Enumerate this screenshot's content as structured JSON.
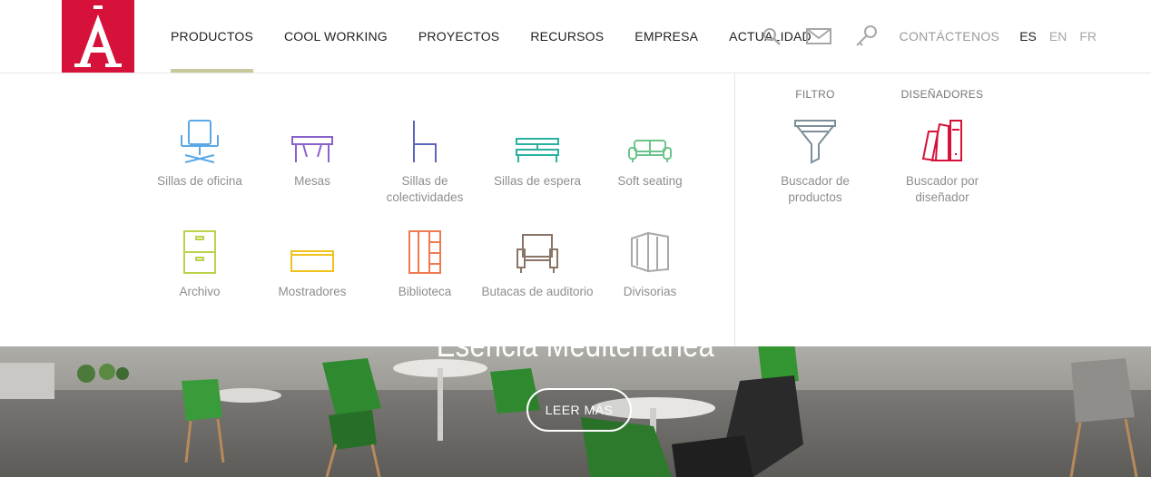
{
  "header": {
    "logo_alt": "Actiu",
    "nav": [
      {
        "label": "PRODUCTOS",
        "active": true
      },
      {
        "label": "COOL WORKING",
        "active": false
      },
      {
        "label": "PROYECTOS",
        "active": false
      },
      {
        "label": "RECURSOS",
        "active": false
      },
      {
        "label": "EMPRESA",
        "active": false
      },
      {
        "label": "ACTUALIDAD",
        "active": false
      }
    ],
    "icons": [
      "search-icon",
      "mail-icon",
      "key-icon"
    ],
    "contact_label": "CONTÁCTENOS",
    "languages": [
      {
        "code": "ES",
        "active": true
      },
      {
        "code": "EN",
        "active": false
      },
      {
        "code": "FR",
        "active": false
      }
    ],
    "accent_color": "#d6123a",
    "active_underline_color": "#c8c99a"
  },
  "menu": {
    "categories": [
      {
        "label": "Sillas de oficina",
        "icon": "office-chair-icon",
        "color": "#5aa9e6"
      },
      {
        "label": "Mesas",
        "icon": "table-icon",
        "color": "#8a63c9"
      },
      {
        "label": "Sillas de colectividades",
        "icon": "stacking-chair-icon",
        "color": "#5b67b8"
      },
      {
        "label": "Sillas de espera",
        "icon": "bench-icon",
        "color": "#2bb1a0"
      },
      {
        "label": "Soft seating",
        "icon": "sofa-icon",
        "color": "#6cc48a"
      },
      {
        "label": "Archivo",
        "icon": "cabinet-icon",
        "color": "#bcd24b"
      },
      {
        "label": "Mostradores",
        "icon": "counter-icon",
        "color": "#f0c21b"
      },
      {
        "label": "Biblioteca",
        "icon": "bookcase-icon",
        "color": "#ef7a52"
      },
      {
        "label": "Butacas de auditorio",
        "icon": "armchair-icon",
        "color": "#8a7467"
      },
      {
        "label": "Divisorias",
        "icon": "partition-icon",
        "color": "#a8a8a8"
      }
    ],
    "tools": [
      {
        "heading": "FILTRO",
        "label": "Buscador de productos",
        "icon": "filter-funnel-icon",
        "color": "#7c8f99"
      },
      {
        "heading": "DISEÑADORES",
        "label": "Buscador por diseñador",
        "icon": "swatch-fan-icon",
        "color": "#d6123a"
      }
    ]
  },
  "hero": {
    "title": "Esencia Mediterránea",
    "cta_label": "LEER MÁS"
  }
}
